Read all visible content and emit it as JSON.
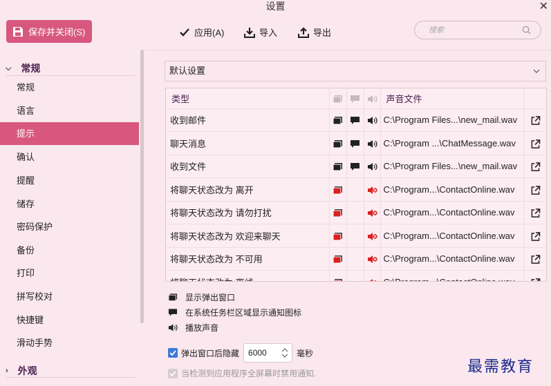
{
  "window": {
    "title": "设置",
    "close": "✕"
  },
  "toolbar": {
    "save_close": "保存并关闭(S)",
    "apply": "应用(A)",
    "import": "导入",
    "export": "导出",
    "search_placeholder": "搜索"
  },
  "sidebar": {
    "cat_general": "常规",
    "cat_appearance": "外观",
    "items": [
      "常规",
      "语言",
      "提示",
      "确认",
      "提醒",
      "储存",
      "密码保护",
      "备份",
      "打印",
      "拼写校对",
      "快捷键",
      "滑动手势"
    ],
    "active_index": 2
  },
  "preset": {
    "value": "默认设置"
  },
  "table": {
    "headers": {
      "type": "类型",
      "sound_file": "声音文件"
    },
    "rows": [
      {
        "type": "收到邮件",
        "file": "C:\\Program Files...\\new_mail.wav",
        "popup": true,
        "tray": true,
        "sound": true
      },
      {
        "type": "聊天消息",
        "file": "C:\\Program ...\\ChatMessage.wav",
        "popup": true,
        "tray": true,
        "sound": true
      },
      {
        "type": "收到文件",
        "file": "C:\\Program Files...\\new_mail.wav",
        "popup": true,
        "tray": true,
        "sound": true
      },
      {
        "type": "将聊天状态改为 离开",
        "file": "C:\\Program...\\ContactOnline.wav",
        "popup": false,
        "tray": false,
        "sound": false
      },
      {
        "type": "将聊天状态改为 请勿打扰",
        "file": "C:\\Program...\\ContactOnline.wav",
        "popup": false,
        "tray": false,
        "sound": false
      },
      {
        "type": "将聊天状态改为 欢迎来聊天",
        "file": "C:\\Program...\\ContactOnline.wav",
        "popup": false,
        "tray": false,
        "sound": false
      },
      {
        "type": "将聊天状态改为 不可用",
        "file": "C:\\Program...\\ContactOnline.wav",
        "popup": false,
        "tray": false,
        "sound": false
      },
      {
        "type": "将聊天状态改为 离线",
        "file": "C:\\Program...\\ContactOnline.wav",
        "popup": false,
        "tray": false,
        "sound": false
      }
    ]
  },
  "legend": {
    "popup": "显示弹出窗口",
    "tray": "在系统任务栏区域显示通知图标",
    "sound": "播放声音"
  },
  "options": {
    "hide_popup_label": "弹出窗口后隐藏",
    "hide_popup_value": "6000",
    "hide_popup_unit": "毫秒",
    "fullscreen_label": "当检测到应用程序全屏幕时禁用通知."
  },
  "watermark": "最需教育",
  "colors": {
    "accent": "#d8577e",
    "background": "#fbe8ef",
    "checkbox": "#3a7bd5",
    "heading": "#4a2050"
  }
}
